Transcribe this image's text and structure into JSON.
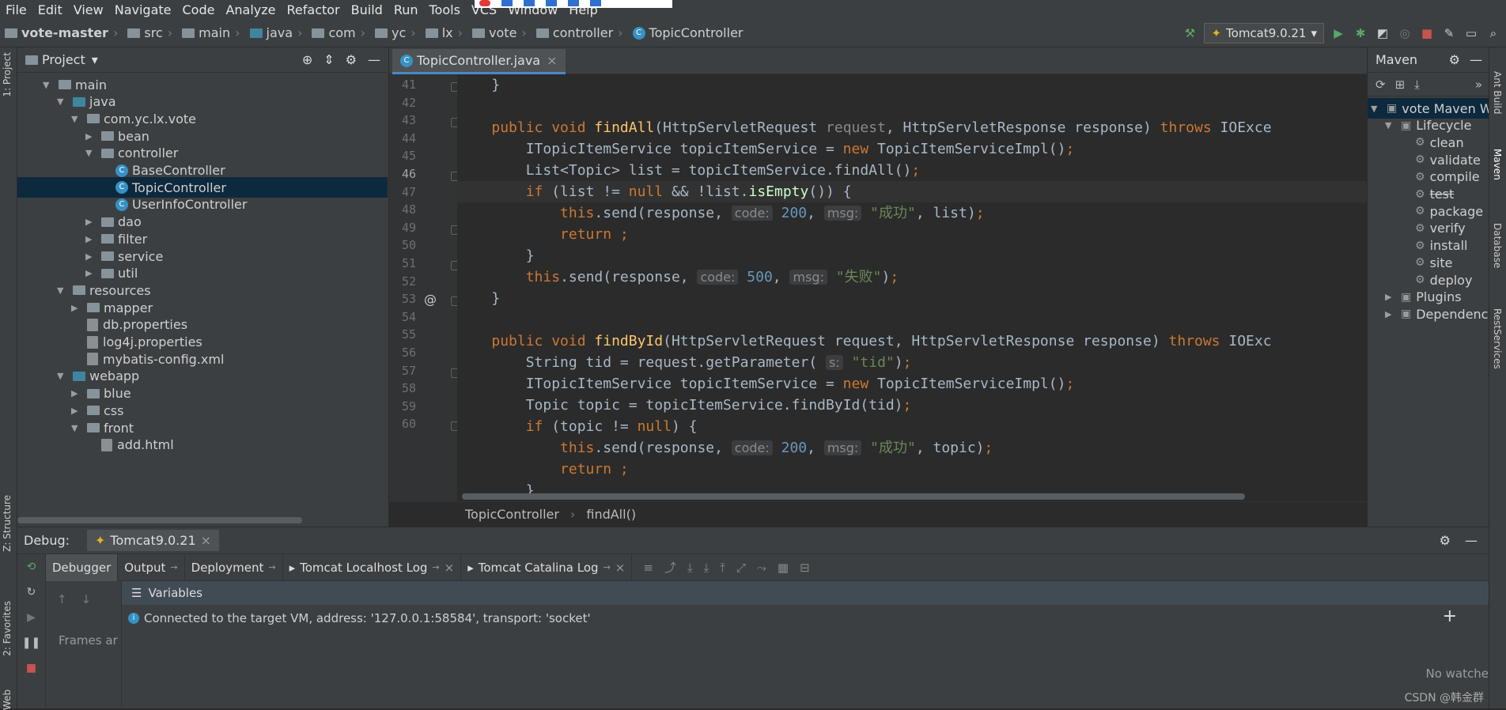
{
  "menu": [
    "File",
    "Edit",
    "View",
    "Navigate",
    "Code",
    "Analyze",
    "Refactor",
    "Build",
    "Run",
    "Tools",
    "VCS",
    "Window",
    "Help"
  ],
  "breadcrumb": [
    "vote-master",
    "src",
    "main",
    "java",
    "com",
    "yc",
    "lx",
    "vote",
    "controller",
    "TopicController"
  ],
  "run_config": "Tomcat9.0.21",
  "project": {
    "title": "Project",
    "tree": [
      {
        "label": "main",
        "depth": 3,
        "arrow": "down",
        "icon": "folder"
      },
      {
        "label": "java",
        "depth": 4,
        "arrow": "down",
        "icon": "folder-blue"
      },
      {
        "label": "com.yc.lx.vote",
        "depth": 5,
        "arrow": "down",
        "icon": "folder"
      },
      {
        "label": "bean",
        "depth": 6,
        "arrow": "right",
        "icon": "folder"
      },
      {
        "label": "controller",
        "depth": 6,
        "arrow": "down",
        "icon": "folder"
      },
      {
        "label": "BaseController",
        "depth": 7,
        "arrow": "",
        "icon": "class"
      },
      {
        "label": "TopicController",
        "depth": 7,
        "arrow": "",
        "icon": "class",
        "selected": true
      },
      {
        "label": "UserInfoController",
        "depth": 7,
        "arrow": "",
        "icon": "class"
      },
      {
        "label": "dao",
        "depth": 6,
        "arrow": "right",
        "icon": "folder"
      },
      {
        "label": "filter",
        "depth": 6,
        "arrow": "right",
        "icon": "folder"
      },
      {
        "label": "service",
        "depth": 6,
        "arrow": "right",
        "icon": "folder"
      },
      {
        "label": "util",
        "depth": 6,
        "arrow": "right",
        "icon": "folder"
      },
      {
        "label": "resources",
        "depth": 4,
        "arrow": "down",
        "icon": "folder"
      },
      {
        "label": "mapper",
        "depth": 5,
        "arrow": "right",
        "icon": "folder"
      },
      {
        "label": "db.properties",
        "depth": 5,
        "arrow": "",
        "icon": "file"
      },
      {
        "label": "log4j.properties",
        "depth": 5,
        "arrow": "",
        "icon": "file"
      },
      {
        "label": "mybatis-config.xml",
        "depth": 5,
        "arrow": "",
        "icon": "file"
      },
      {
        "label": "webapp",
        "depth": 4,
        "arrow": "down",
        "icon": "folder-blue"
      },
      {
        "label": "blue",
        "depth": 5,
        "arrow": "right",
        "icon": "folder"
      },
      {
        "label": "css",
        "depth": 5,
        "arrow": "right",
        "icon": "folder"
      },
      {
        "label": "front",
        "depth": 5,
        "arrow": "down",
        "icon": "folder"
      },
      {
        "label": "add.html",
        "depth": 6,
        "arrow": "",
        "icon": "file"
      }
    ]
  },
  "editor": {
    "tab": "TopicController.java",
    "line_numbers": [
      "41",
      "42",
      "43",
      "44",
      "45",
      "46",
      "47",
      "48",
      "49",
      "50",
      "51",
      "52",
      "53",
      "54",
      "55",
      "56",
      "57",
      "58",
      "59",
      "60"
    ],
    "current_line": "46",
    "breadcrumb": [
      "TopicController",
      "findAll()"
    ]
  },
  "maven": {
    "title": "Maven",
    "project": "vote Maven W",
    "lifecycle": "Lifecycle",
    "goals": [
      "clean",
      "validate",
      "compile",
      "test",
      "package",
      "verify",
      "install",
      "site",
      "deploy"
    ],
    "plugins": "Plugins",
    "dependencies": "Dependenc"
  },
  "right_tabs": [
    "Ant Build",
    "Maven",
    "Database",
    "RestServices"
  ],
  "left_tabs": [
    "1: Project",
    "Z: Structure",
    "2: Favorites",
    "Web"
  ],
  "debug": {
    "label": "Debug:",
    "session": "Tomcat9.0.21",
    "tabs": [
      "Debugger",
      "Output",
      "Deployment",
      "Tomcat Localhost Log",
      "Tomcat Catalina Log"
    ],
    "frames_label": "Frames ar",
    "variables_label": "Variables",
    "message": "Connected to the target VM, address: '127.0.0.1:58584', transport: 'socket'",
    "watches": "No watche",
    "watermark": "CSDN @韩金群"
  }
}
